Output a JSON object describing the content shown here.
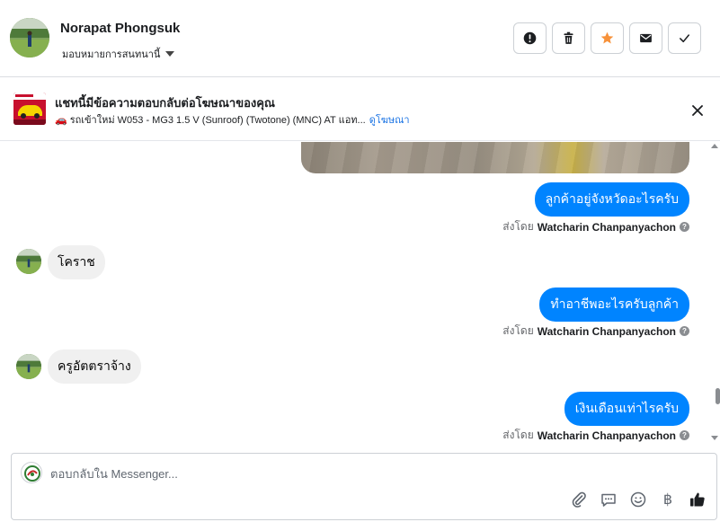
{
  "header": {
    "name": "Norapat Phongsuk",
    "assign_label": "มอบหมายการสนทนานี้"
  },
  "header_actions": [
    {
      "name": "report-icon"
    },
    {
      "name": "trash-icon"
    },
    {
      "name": "star-icon",
      "color": "#f7923a"
    },
    {
      "name": "envelope-icon"
    },
    {
      "name": "check-icon"
    }
  ],
  "ad": {
    "title": "แชทนี้มีข้อความตอบกลับต่อโฆษณาของคุณ",
    "subtitle": "รถเข้าใหม่ W053 - MG3 1.5 V (Sunroof) (Twotone) (MNC) AT แอท...",
    "link": "ดูโฆษณา"
  },
  "messages": [
    {
      "direction": "out",
      "text": "ลูกค้าอยู่จังหวัดอะไรครับ",
      "sent_by_label": "ส่งโดย",
      "sender": "Watcharin Chanpanyachon"
    },
    {
      "direction": "in",
      "text": "โคราช"
    },
    {
      "direction": "out",
      "text": "ทำอาชีพอะไรครับลูกค้า",
      "sent_by_label": "ส่งโดย",
      "sender": "Watcharin Chanpanyachon"
    },
    {
      "direction": "in",
      "text": "ครูอัตตราจ้าง"
    },
    {
      "direction": "out",
      "text": "เงินเดือนเท่าไรครับ",
      "sent_by_label": "ส่งโดย",
      "sender": "Watcharin Chanpanyachon"
    }
  ],
  "composer": {
    "placeholder": "ตอบกลับใน Messenger..."
  },
  "composer_tools": [
    {
      "name": "paperclip-icon"
    },
    {
      "name": "saved-reply-icon"
    },
    {
      "name": "emoji-icon"
    },
    {
      "name": "baht-icon",
      "glyph": "฿"
    },
    {
      "name": "thumbs-up-icon"
    }
  ],
  "colors": {
    "accent": "#0084ff",
    "link": "#1b74e4",
    "star": "#f7923a"
  }
}
